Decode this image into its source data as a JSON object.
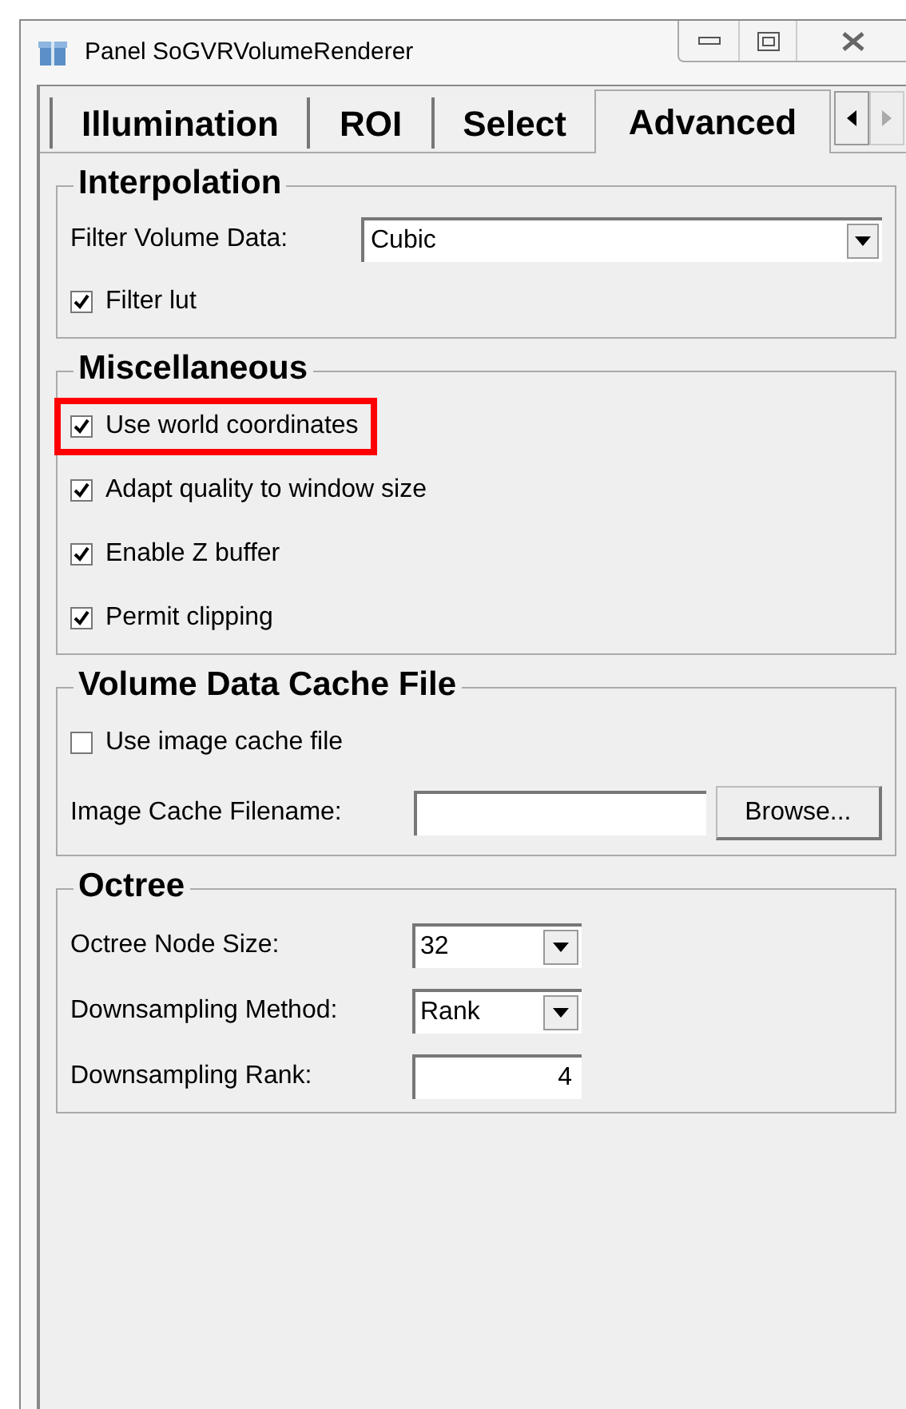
{
  "window": {
    "title": "Panel SoGVRVolumeRenderer"
  },
  "tabs": [
    {
      "label": "Illumination",
      "selected": false
    },
    {
      "label": "ROI",
      "selected": false
    },
    {
      "label": "Select",
      "selected": false
    },
    {
      "label": "Advanced",
      "selected": true
    }
  ],
  "groups": [
    {
      "title": "Interpolation",
      "rows": [
        {
          "kind": "combo",
          "label": "Filter Volume Data:",
          "value": "Cubic"
        },
        {
          "kind": "checkbox",
          "label": "Filter lut",
          "checked": true,
          "highlighted": false
        }
      ]
    },
    {
      "title": "Miscellaneous",
      "rows": [
        {
          "kind": "checkbox",
          "label": "Use world coordinates",
          "checked": true,
          "highlighted": true
        },
        {
          "kind": "checkbox",
          "label": "Adapt quality to window size",
          "checked": true,
          "highlighted": false
        },
        {
          "kind": "checkbox",
          "label": "Enable Z buffer",
          "checked": true,
          "highlighted": false
        },
        {
          "kind": "checkbox",
          "label": "Permit clipping",
          "checked": true,
          "highlighted": false
        }
      ]
    },
    {
      "title": "Volume Data Cache File",
      "rows": [
        {
          "kind": "checkbox",
          "label": "Use image cache file",
          "checked": false,
          "highlighted": false
        },
        {
          "kind": "file",
          "label": "Image Cache Filename:",
          "button": "Browse..."
        }
      ]
    },
    {
      "title": "Octree",
      "rows": [
        {
          "kind": "dropdown",
          "label": "Octree Node Size:",
          "value": "32"
        },
        {
          "kind": "dropdown",
          "label": "Downsampling Method:",
          "value": "Rank"
        },
        {
          "kind": "number",
          "label": "Downsampling Rank:",
          "value": "4"
        }
      ]
    }
  ]
}
